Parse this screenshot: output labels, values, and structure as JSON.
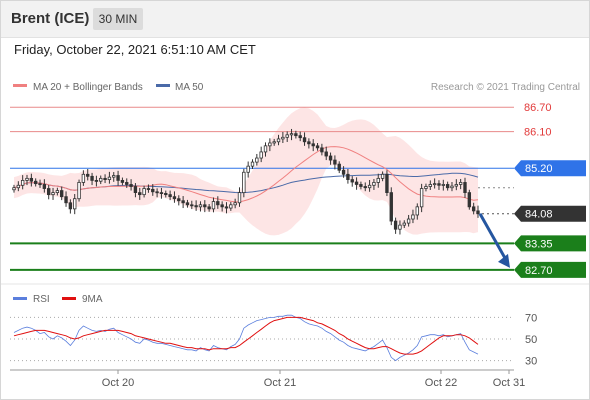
{
  "header": {
    "title": "Brent (ICE)",
    "timeframe": "30 MIN"
  },
  "datetime": "Friday, October 22, 2021 6:51:10 AM CET",
  "colors": {
    "resistance": "#e88a8a",
    "pivot": "#2f73e8",
    "last": "#333333",
    "support": "#1b7f1b",
    "bollinger_fill": "#fde0e0",
    "ma20": "#f08080",
    "ma50": "#4a6aa8",
    "candle_up": "#ffffff",
    "candle_down": "#333333",
    "arrow": "#2556a0",
    "rsi": "#5b7fdd",
    "rsi_ma": "#e01010"
  },
  "legend": {
    "ma20": "MA 20 + Bollinger Bands",
    "ma50": "MA 50"
  },
  "copyright": "Research © 2021 Trading Central",
  "rsi_legend": {
    "rsi": "RSI",
    "ma": "9MA"
  },
  "chart_data": [
    {
      "type": "candlestick",
      "ylim": [
        82.5,
        87.0
      ],
      "levels": [
        {
          "label": "86.70",
          "value": 86.7,
          "kind": "resistance"
        },
        {
          "label": "86.10",
          "value": 86.1,
          "kind": "resistance"
        },
        {
          "label": "85.20",
          "value": 85.2,
          "kind": "pivot"
        },
        {
          "label": "84.08",
          "value": 84.08,
          "kind": "last"
        },
        {
          "label": "83.35",
          "value": 83.35,
          "kind": "support"
        },
        {
          "label": "82.70",
          "value": 82.7,
          "kind": "support"
        }
      ],
      "x_ticks": [
        "Oct 20",
        "Oct 21",
        "Oct 22",
        "Oct 31"
      ],
      "close": [
        84.72,
        84.78,
        84.9,
        84.95,
        84.88,
        84.82,
        84.8,
        84.7,
        84.55,
        84.6,
        84.65,
        84.5,
        84.35,
        84.2,
        84.45,
        84.85,
        85.05,
        85.0,
        84.9,
        84.88,
        84.95,
        84.92,
        84.98,
        85.02,
        84.9,
        84.85,
        84.8,
        84.75,
        84.6,
        84.55,
        84.7,
        84.68,
        84.62,
        84.6,
        84.58,
        84.55,
        84.5,
        84.45,
        84.4,
        84.35,
        84.3,
        84.28,
        84.25,
        84.3,
        84.25,
        84.2,
        84.38,
        84.3,
        84.25,
        84.22,
        84.3,
        84.35,
        84.6,
        85.1,
        85.25,
        85.35,
        85.45,
        85.6,
        85.75,
        85.82,
        85.85,
        85.92,
        85.96,
        86.02,
        86.05,
        86.0,
        85.95,
        85.85,
        85.8,
        85.75,
        85.7,
        85.6,
        85.5,
        85.4,
        85.3,
        85.15,
        85.05,
        84.92,
        84.86,
        84.8,
        84.75,
        84.72,
        84.78,
        84.85,
        84.95,
        85.05,
        84.6,
        83.9,
        83.7,
        83.8,
        83.85,
        83.95,
        84.05,
        84.25,
        84.7,
        84.75,
        84.8,
        84.82,
        84.78,
        84.8,
        84.72,
        84.76,
        84.8,
        84.85,
        84.6,
        84.25,
        84.15,
        84.08
      ]
    },
    {
      "type": "line",
      "ylim": [
        25,
        75
      ],
      "y_ticks": [
        70,
        50,
        30
      ],
      "series": [
        {
          "name": "RSI",
          "values": [
            56,
            58,
            60,
            61,
            60,
            58,
            55,
            56,
            52,
            50,
            53,
            51,
            48,
            44,
            49,
            58,
            62,
            60,
            58,
            57,
            58,
            57,
            59,
            60,
            56,
            54,
            52,
            50,
            47,
            46,
            50,
            49,
            47,
            46,
            46,
            45,
            44,
            43,
            42,
            41,
            40,
            40,
            39,
            42,
            40,
            39,
            44,
            42,
            41,
            40,
            43,
            45,
            50,
            60,
            63,
            65,
            67,
            68,
            69,
            70,
            70,
            71,
            71,
            72,
            72,
            70,
            69,
            66,
            64,
            63,
            62,
            60,
            57,
            55,
            52,
            49,
            47,
            44,
            42,
            41,
            40,
            39,
            41,
            43,
            46,
            49,
            42,
            33,
            30,
            33,
            35,
            37,
            40,
            44,
            52,
            53,
            54,
            54,
            53,
            54,
            52,
            53,
            54,
            55,
            47,
            40,
            38,
            36
          ]
        },
        {
          "name": "9MA",
          "values": [
            53,
            54,
            55,
            56,
            57,
            58,
            58,
            58,
            57,
            56,
            55,
            54,
            53,
            51,
            50,
            51,
            53,
            54,
            55,
            56,
            57,
            58,
            58,
            58,
            58,
            57,
            56,
            55,
            53,
            52,
            51,
            50,
            49,
            48,
            47,
            46,
            46,
            45,
            44,
            43,
            42,
            42,
            41,
            41,
            41,
            40,
            41,
            41,
            41,
            41,
            42,
            42,
            44,
            47,
            50,
            53,
            56,
            59,
            62,
            65,
            67,
            68,
            69,
            70,
            70,
            70,
            70,
            69,
            68,
            67,
            65,
            64,
            62,
            60,
            58,
            55,
            53,
            50,
            48,
            46,
            44,
            42,
            41,
            41,
            42,
            43,
            43,
            41,
            39,
            37,
            36,
            36,
            36,
            37,
            39,
            42,
            45,
            48,
            51,
            53,
            53,
            53,
            54,
            54,
            53,
            51,
            48,
            45
          ]
        }
      ]
    }
  ]
}
